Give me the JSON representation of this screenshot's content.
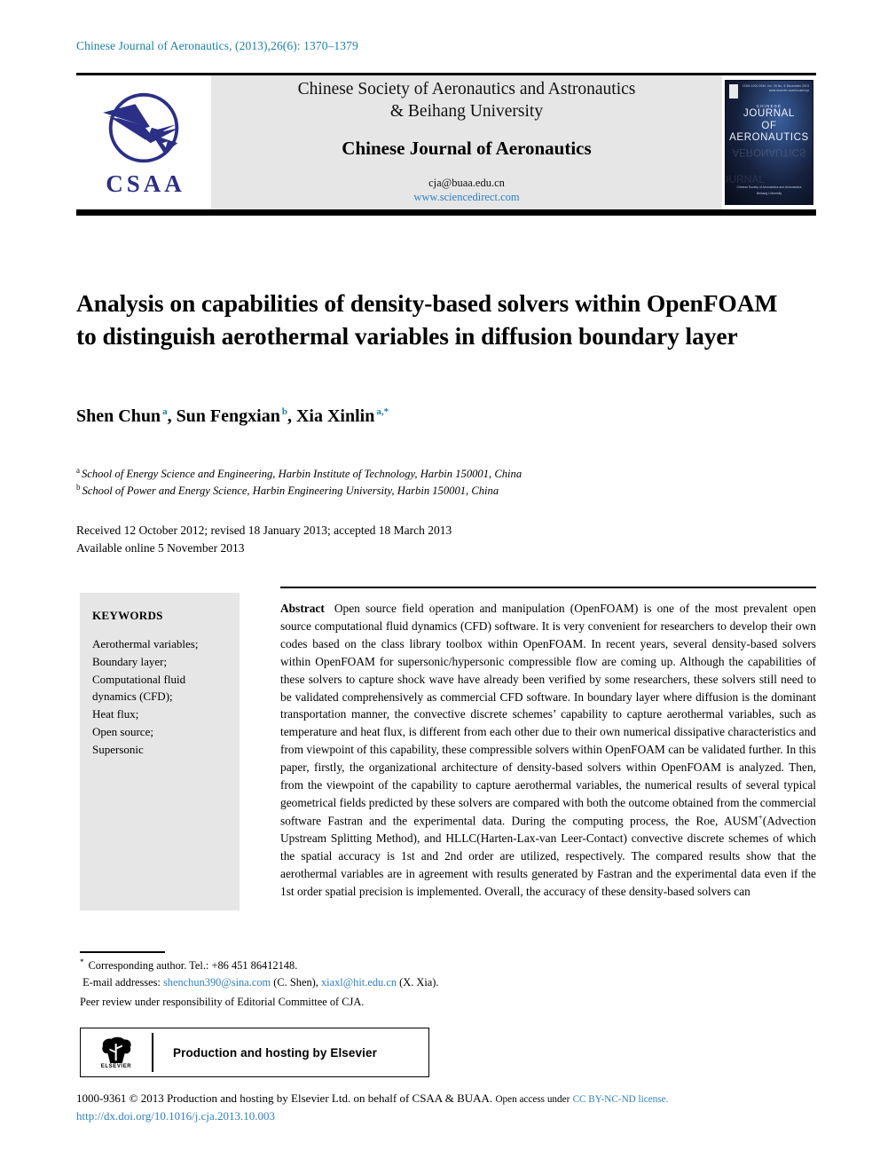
{
  "running_head": "Chinese Journal of Aeronautics, (2013),26(6): 1370–1379",
  "masthead": {
    "logo_text": "CSAA",
    "logo_icon": "csaa-aircraft-logo",
    "society_line1": "Chinese Society of Aeronautics and Astronautics",
    "society_line2": "& Beihang University",
    "journal_name": "Chinese Journal of Aeronautics",
    "email": "cja@buaa.edu.cn",
    "url": "www.sciencedirect.com",
    "cover": {
      "publisher_mark": "elsevier-mark",
      "issn_block": "ISSN 1000-9361\nVol. 26 No. 6 December 2013\nwww.elsevier.com/locate/cja",
      "line_small": "CHINESE",
      "line_1": "JOURNAL",
      "line_2": "OF",
      "line_3": "AERONAUTICS",
      "footer_1": "Chinese Society of Aeronautics and Astronautics",
      "footer_2": "Beihang University"
    }
  },
  "article": {
    "title": "Analysis on capabilities of density-based solvers within OpenFOAM to distinguish aerothermal variables in diffusion boundary layer",
    "authors": [
      {
        "name": "Shen Chun",
        "marks": "a"
      },
      {
        "name": "Sun Fengxian",
        "marks": "b"
      },
      {
        "name": "Xia Xinlin",
        "marks": "a,*"
      }
    ],
    "affiliations": [
      {
        "mark": "a",
        "text": "School of Energy Science and Engineering, Harbin Institute of Technology, Harbin 150001, China"
      },
      {
        "mark": "b",
        "text": "School of Power and Energy Science, Harbin Engineering University, Harbin 150001, China"
      }
    ],
    "history_line1": "Received 12 October 2012; revised 18 January 2013; accepted 18 March 2013",
    "history_line2": "Available online 5 November 2013"
  },
  "keywords": {
    "heading": "KEYWORDS",
    "items": [
      "Aerothermal variables;",
      "Boundary layer;",
      "Computational fluid",
      "dynamics (CFD);",
      "Heat flux;",
      "Open source;",
      "Supersonic"
    ]
  },
  "abstract": {
    "label": "Abstract",
    "text": "Open source field operation and manipulation (OpenFOAM) is one of the most prevalent open source computational fluid dynamics (CFD) software. It is very convenient for researchers to develop their own codes based on the class library toolbox within OpenFOAM. In recent years, several density-based solvers within OpenFOAM for supersonic/hypersonic compressible flow are coming up. Although the capabilities of these solvers to capture shock wave have already been verified by some researchers, these solvers still need to be validated comprehensively as commercial CFD software. In boundary layer where diffusion is the dominant transportation manner, the convective discrete schemes’ capability to capture aerothermal variables, such as temperature and heat flux, is different from each other due to their own numerical dissipative characteristics and from viewpoint of this capability, these compressible solvers within OpenFOAM can be validated further. In this paper, firstly, the organizational architecture of density-based solvers within OpenFOAM is analyzed. Then, from the viewpoint of the capability to capture aerothermal variables, the numerical results of several typical geometrical fields predicted by these solvers are compared with both the outcome obtained from the commercial software Fastran and the experimental data. During the computing process, the Roe, AUSM",
    "sup1": "+",
    "text2": "(Advection Upstream Splitting Method), and HLLC(Harten-Lax-van Leer-Contact) convective discrete schemes of which the spatial accuracy is 1st and 2nd order are utilized, respectively. The compared results show that the aerothermal variables are in agreement with results generated by Fastran and the experimental data even if the 1st order spatial precision is implemented. Overall, the accuracy of these density-based solvers can"
  },
  "footnotes": {
    "corresponding": "Corresponding author. Tel.: +86 451 86412148.",
    "email_label": "E-mail addresses:",
    "email1": "shenchun390@sina.com",
    "email1_owner": "(C. Shen),",
    "email2": "xiaxl@hit.edu.cn",
    "email2_owner": "(X. Xia).",
    "peer_review": "Peer review under responsibility of Editorial Committee of CJA."
  },
  "elsevier_banner": {
    "logo_name": "elsevier-tree-logo",
    "logo_word": "ELSEVIER",
    "caption": "Production and hosting by Elsevier"
  },
  "colophon": {
    "line1_a": "1000-9361 © 2013 Production and hosting by Elsevier Ltd. on behalf of CSAA & BUAA.",
    "line1_b": "Open access under",
    "license": "CC BY-NC-ND license.",
    "doi": "http://dx.doi.org/10.1016/j.cja.2013.10.003"
  },
  "colors": {
    "link_blue": "#2f7fc1",
    "running_head_blue": "#1a7fa8",
    "logo_navy": "#2b2f86",
    "panel_grey": "#e6e6e6"
  }
}
